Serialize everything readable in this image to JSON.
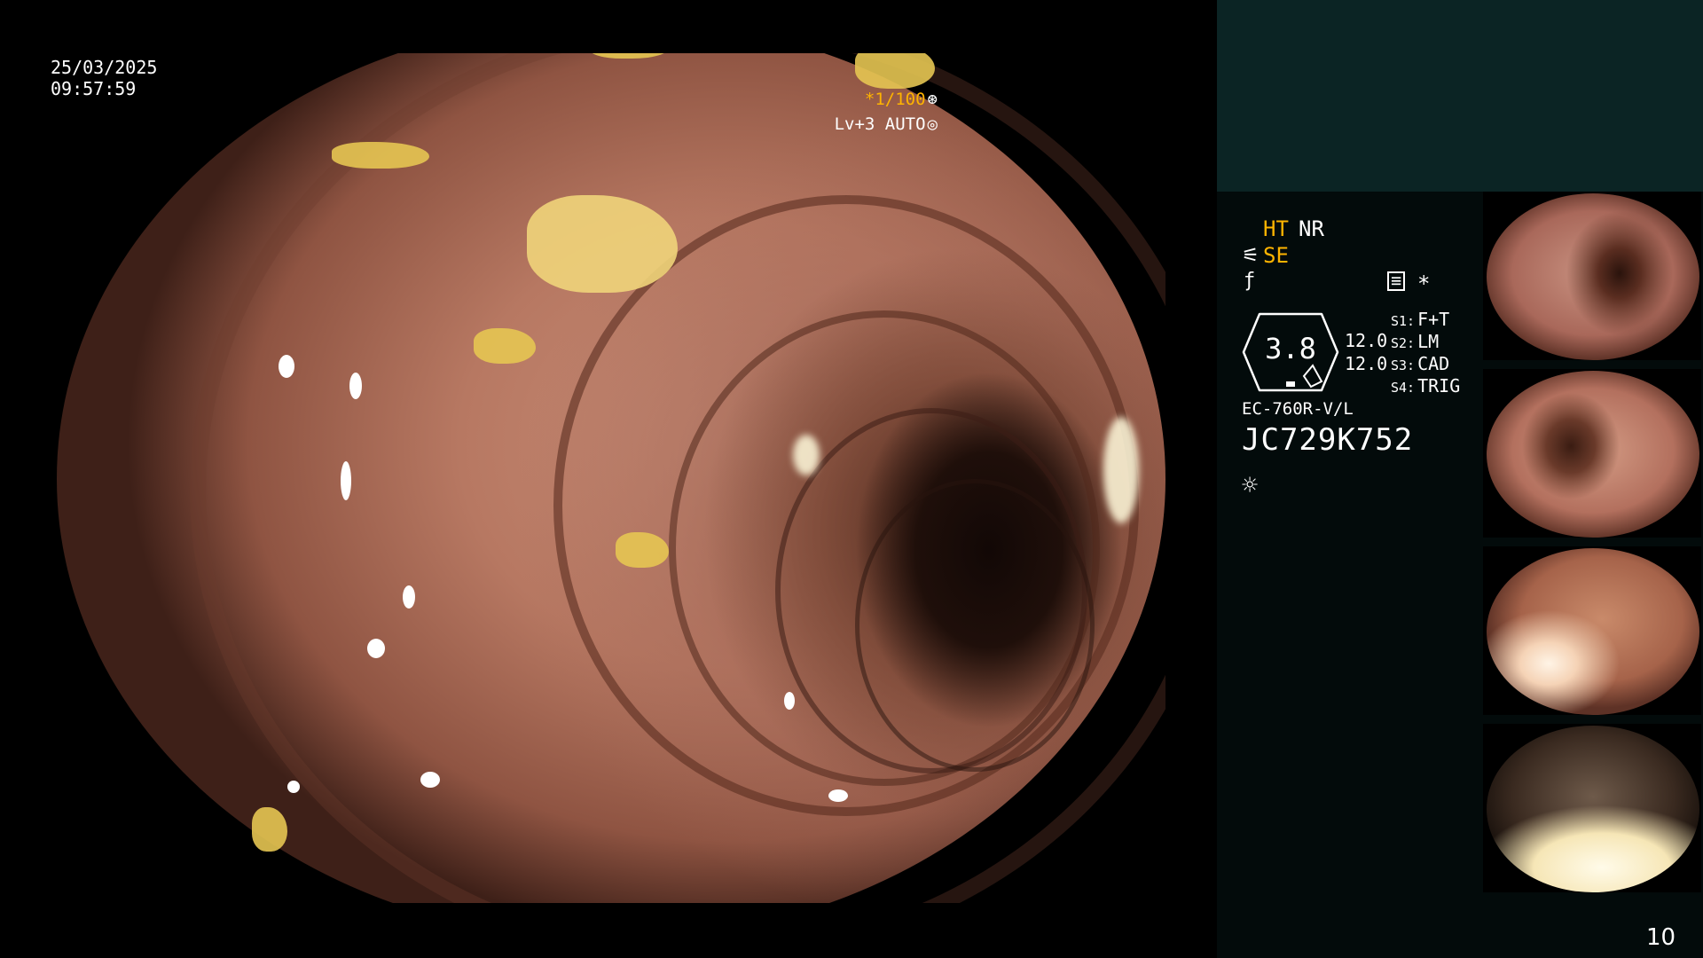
{
  "overlay": {
    "date": "25/03/2025",
    "time": "09:57:59",
    "shutter": "*1/100",
    "level": "Lv+3 AUTO"
  },
  "panel": {
    "mode_ht": "HT",
    "mode_nr": "NR",
    "mode_se": "SE",
    "gauge_value": "3.8",
    "value_a": "12.0",
    "value_b": "12.0",
    "slots": [
      {
        "key": "S1:",
        "value": "F+T"
      },
      {
        "key": "S2:",
        "value": "LM"
      },
      {
        "key": "S3:",
        "value": "CAD"
      },
      {
        "key": "S4:",
        "value": "TRIG"
      }
    ],
    "scope_model": "EC-760R-V/L",
    "scope_serial": "JC729K752",
    "star": "*",
    "page_number": "10"
  },
  "icons": {
    "shutter": "aperture-icon",
    "level": "auto-iris-icon",
    "structure_enhance": "scissors-icon",
    "freeze": "freeze-icon",
    "memo": "memo-icon",
    "light": "light-source-icon"
  },
  "colors": {
    "accent_orange": "#ffb400",
    "panel_top": "#0b2424",
    "panel_bg": "#030b0b"
  }
}
